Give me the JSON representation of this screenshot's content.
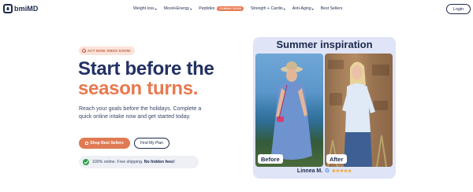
{
  "brand": {
    "name": "bmiMD"
  },
  "nav": {
    "items": [
      {
        "label": "Weight loss",
        "caret": "▾"
      },
      {
        "label": "Mood+Energy",
        "caret": "▾"
      },
      {
        "label": "Peptides",
        "badge": "COMING SOON"
      },
      {
        "label": "Strength + Cardio",
        "caret": "▾"
      },
      {
        "label": "Anti-Aging",
        "caret": "▾"
      },
      {
        "label": "Best Sellers"
      }
    ],
    "login_label": "Login"
  },
  "hero": {
    "urgency_label": "ACT NOW. ENDS SOON!",
    "headline_line1": "Start before the",
    "headline_line2": "season turns.",
    "subtext": "Reach your goals before the holidays. Complete a quick online intake now and get started today.",
    "primary_cta": "Shop Best Sellers",
    "secondary_cta": "Find My Plan",
    "promo_text": "100% online. Free shipping.",
    "promo_bold": "No hidden fees!"
  },
  "testimonial": {
    "title": "Summer inspiration",
    "before_label": "Before",
    "after_label": "After",
    "reviewer_name": "Linnea M.",
    "rating_icon": "google-icon",
    "stars": "★★★★★",
    "rating": 5
  },
  "colors": {
    "navy": "#1d2a4d",
    "accent": "#e8794e",
    "card_bg": "#dfe5f7",
    "success": "#2e9f47"
  }
}
